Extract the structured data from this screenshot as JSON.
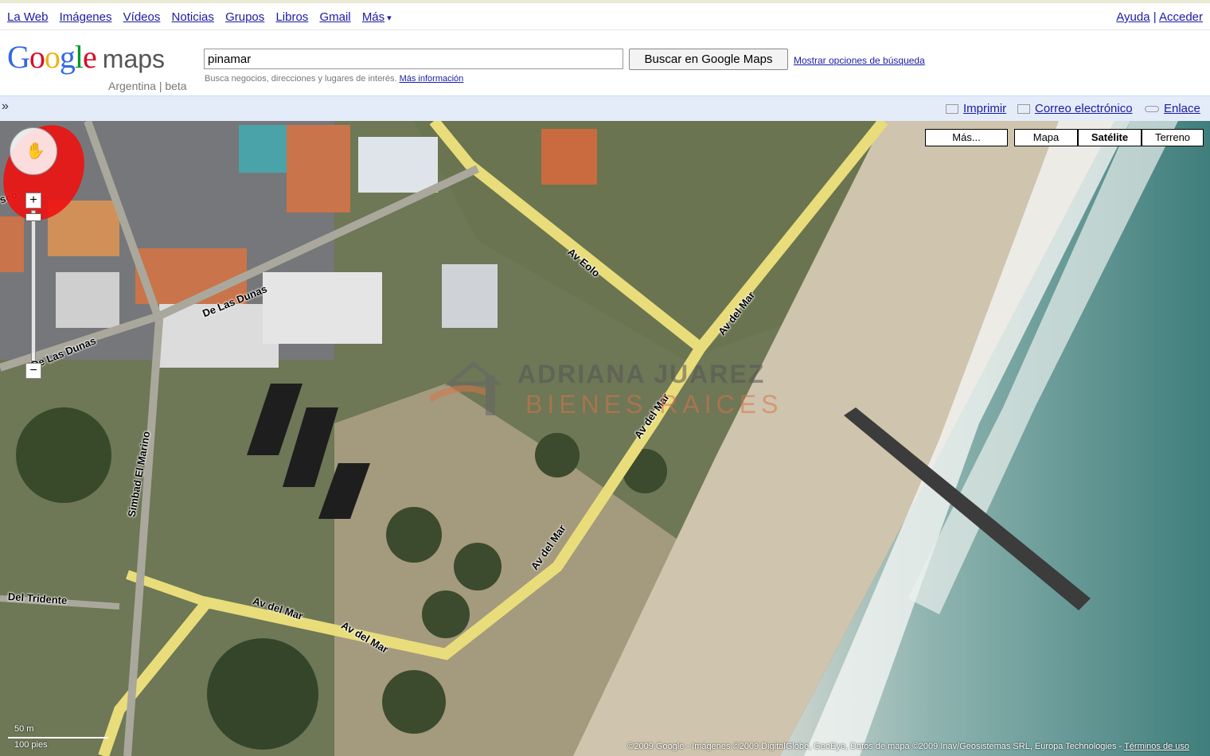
{
  "topnav": {
    "links": [
      "La Web",
      "Imágenes",
      "Vídeos",
      "Noticias",
      "Grupos",
      "Libros",
      "Gmail",
      "Más"
    ],
    "more_caret": "▾",
    "help": "Ayuda",
    "separator": "|",
    "signin": "Acceder"
  },
  "logo": {
    "brand": "Google",
    "product": "maps",
    "subtitle": "Argentina | beta"
  },
  "search": {
    "value": "pinamar",
    "button": "Buscar en Google Maps",
    "options": "Mostrar opciones de búsqueda",
    "hint": "Busca negocios, direcciones y lugares de interés.",
    "hint_link": "Más información"
  },
  "actions": {
    "collapse": "»",
    "print": "Imprimir",
    "email": "Correo electrónico",
    "link": "Enlace"
  },
  "map_types": {
    "more": "Más...",
    "map": "Mapa",
    "satellite": "Satélite",
    "terrain": "Terreno",
    "active": "Satélite"
  },
  "road_labels": [
    "Av Eolo",
    "Av del Mar",
    "De Las Dunas",
    "De Las Dunas",
    "Av del Mar",
    "Av del Mar",
    "Simbad El Marino",
    "Av del Mar",
    "Av del Mar",
    "Del Tridente",
    "seo"
  ],
  "controls": {
    "zoom_in": "+",
    "zoom_out": "−",
    "pan_icon": "✋"
  },
  "scale": {
    "metric": "50 m",
    "imperial": "100 pies"
  },
  "copyright": {
    "text": "©2009 Google - Imágenes ©2009 DigitalGlobe, GeoEye, Datos de mapa ©2009 Inav/Geosistemas SRL, Europa Technologies -",
    "terms": "Términos de uso"
  },
  "watermark": {
    "name": "ADRIANA JUAREZ",
    "sub": "BIENES RAICES"
  },
  "colors": {
    "link": "#1a1aa6",
    "action_bar": "#e5ecf9",
    "road": "#e8dd7a",
    "pin": "#ee1111"
  }
}
